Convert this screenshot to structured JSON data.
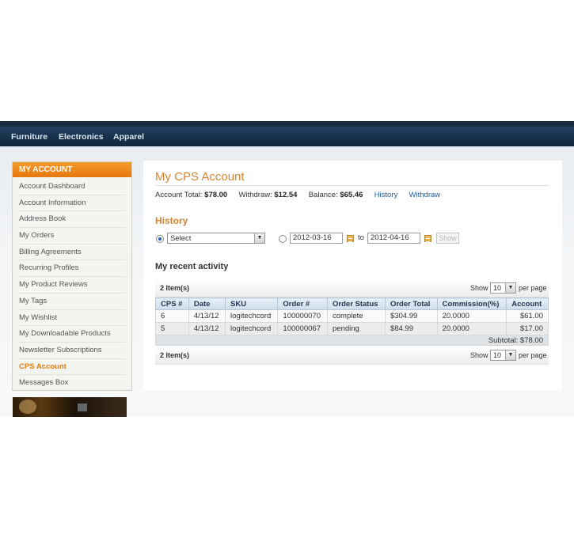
{
  "nav": [
    "Furniture",
    "Electronics",
    "Apparel"
  ],
  "sidebar": {
    "title": "MY ACCOUNT",
    "items": [
      {
        "label": "Account Dashboard"
      },
      {
        "label": "Account Information"
      },
      {
        "label": "Address Book"
      },
      {
        "label": "My Orders"
      },
      {
        "label": "Billing Agreements"
      },
      {
        "label": "Recurring Profiles"
      },
      {
        "label": "My Product Reviews"
      },
      {
        "label": "My Tags"
      },
      {
        "label": "My Wishlist"
      },
      {
        "label": "My Downloadable Products"
      },
      {
        "label": "Newsletter Subscriptions"
      },
      {
        "label": "CPS Account",
        "active": true
      },
      {
        "label": "Messages Box"
      }
    ]
  },
  "page": {
    "title": "My CPS Account",
    "summary": {
      "total_label": "Account Total:",
      "total": "$78.00",
      "withdraw_label": "Withdraw:",
      "withdraw": "$12.54",
      "balance_label": "Balance:",
      "balance": "$65.46",
      "history_link": "History",
      "withdraw_link": "Withdraw"
    }
  },
  "history": {
    "heading": "History",
    "period_select": "Select",
    "date_from": "2012-03-16",
    "to_label": "to",
    "date_to": "2012-04-16",
    "show_button": "Show"
  },
  "activity": {
    "heading": "My recent activity",
    "count": "2 Item(s)",
    "show_label": "Show",
    "per_page": "10",
    "per_page_label": "per page",
    "columns": [
      "CPS #",
      "Date",
      "SKU",
      "Order #",
      "Order Status",
      "Order Total",
      "Commission(%)",
      "Account"
    ],
    "rows": [
      [
        "6",
        "4/13/12",
        "logitechcord",
        "100000070",
        "complete",
        "$304.99",
        "20.0000",
        "$61.00"
      ],
      [
        "5",
        "4/13/12",
        "logitechcord",
        "100000067",
        "pending",
        "$84.99",
        "20.0000",
        "$17.00"
      ]
    ],
    "subtotal": "Subtotal: $78.00"
  },
  "colors": {
    "accent_orange": "#e57f12",
    "nav_background": "#10253b",
    "link_blue": "#1e5b9a"
  }
}
